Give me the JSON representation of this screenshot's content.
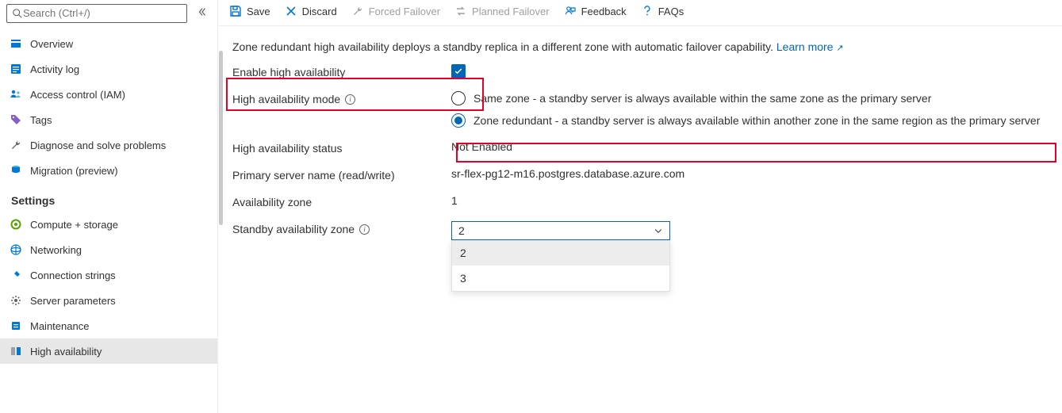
{
  "search": {
    "placeholder": "Search (Ctrl+/)"
  },
  "sidebar": {
    "itemsTop": [
      {
        "label": "Overview"
      },
      {
        "label": "Activity log"
      },
      {
        "label": "Access control (IAM)"
      },
      {
        "label": "Tags"
      },
      {
        "label": "Diagnose and solve problems"
      },
      {
        "label": "Migration (preview)"
      }
    ],
    "settingsTitle": "Settings",
    "itemsSettings": [
      {
        "label": "Compute + storage"
      },
      {
        "label": "Networking"
      },
      {
        "label": "Connection strings"
      },
      {
        "label": "Server parameters"
      },
      {
        "label": "Maintenance"
      },
      {
        "label": "High availability"
      }
    ]
  },
  "toolbar": {
    "save": "Save",
    "discard": "Discard",
    "forcedFailover": "Forced Failover",
    "plannedFailover": "Planned Failover",
    "feedback": "Feedback",
    "faqs": "FAQs"
  },
  "body": {
    "desc": "Zone redundant high availability deploys a standby replica in a different zone with automatic failover capability. ",
    "learnMore": "Learn more",
    "enableHALabel": "Enable high availability",
    "haModeLabel": "High availability mode",
    "radioSameZone": "Same zone - a standby server is always available within the same zone as the primary server",
    "radioZoneRedundant": "Zone redundant - a standby server is always available within another zone in the same region as the primary server",
    "haStatusLabel": "High availability status",
    "haStatusValue": "Not Enabled",
    "primaryNameLabel": "Primary server name (read/write)",
    "primaryNameValue": "sr-flex-pg12-m16.postgres.database.azure.com",
    "availZoneLabel": "Availability zone",
    "availZoneValue": "1",
    "standbyZoneLabel": "Standby availability zone",
    "standbySelected": "2",
    "standbyOptions": [
      "2",
      "3"
    ]
  }
}
